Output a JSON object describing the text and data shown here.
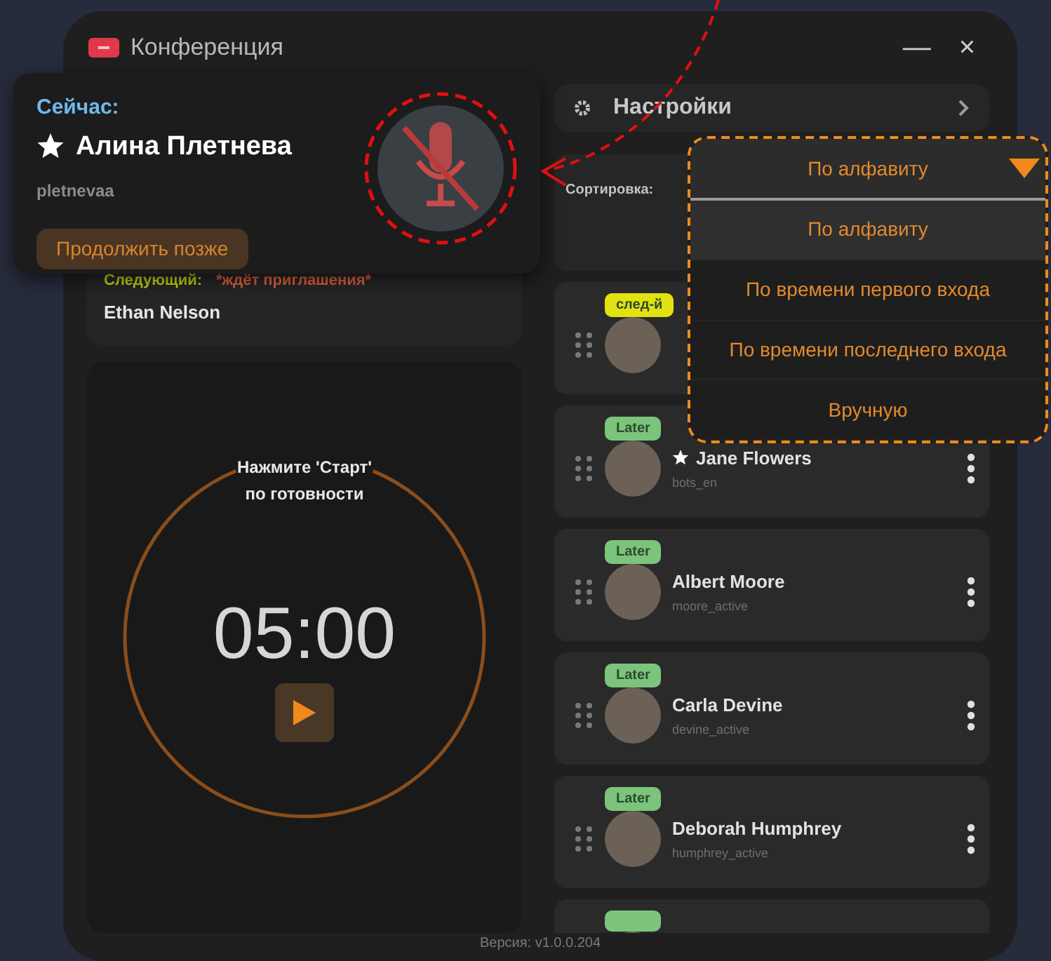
{
  "window": {
    "title": "Конференция",
    "minimize": "—",
    "close": "×"
  },
  "now_card": {
    "label": "Сейчас:",
    "starred": true,
    "name": "Алина Плетнева",
    "username": "pletnevaa",
    "later_button": "Продолжить позже",
    "muted": true
  },
  "next": {
    "label": "Следующий:",
    "status": "*ждёт приглашения*",
    "name": "Ethan Nelson"
  },
  "timer": {
    "hint": "Нажмите 'Старт' по готовности",
    "time": "05:00"
  },
  "settings": {
    "label": "Настройки"
  },
  "sort": {
    "label": "Сортировка:"
  },
  "participants": [
    {
      "badge": {
        "text": "след-й",
        "color": "#e2e210"
      }
    },
    {
      "badge": {
        "text": "Later",
        "color": "#7cc47c"
      },
      "starred": true,
      "name": "Jane Flowers",
      "username": "bots_en"
    },
    {
      "badge": {
        "text": "Later",
        "color": "#7cc47c"
      },
      "starred": false,
      "name": "Albert Moore",
      "username": "moore_active"
    },
    {
      "badge": {
        "text": "Later",
        "color": "#7cc47c"
      },
      "starred": false,
      "name": "Carla Devine",
      "username": "devine_active"
    },
    {
      "badge": {
        "text": "Later",
        "color": "#7cc47c"
      },
      "starred": false,
      "name": "Deborah Humphrey",
      "username": "humphrey_active"
    },
    {
      "badge": {
        "color": "#7cc47c"
      }
    }
  ],
  "dropdown": {
    "value": "По алфавиту",
    "options": [
      {
        "label": "По алфавиту",
        "selected": true
      },
      {
        "label": "По времени первого входа",
        "selected": false
      },
      {
        "label": "По времени последнего входа",
        "selected": false
      },
      {
        "label": "Вручную",
        "selected": false
      }
    ]
  },
  "version": "Версия: v1.0.0.204"
}
